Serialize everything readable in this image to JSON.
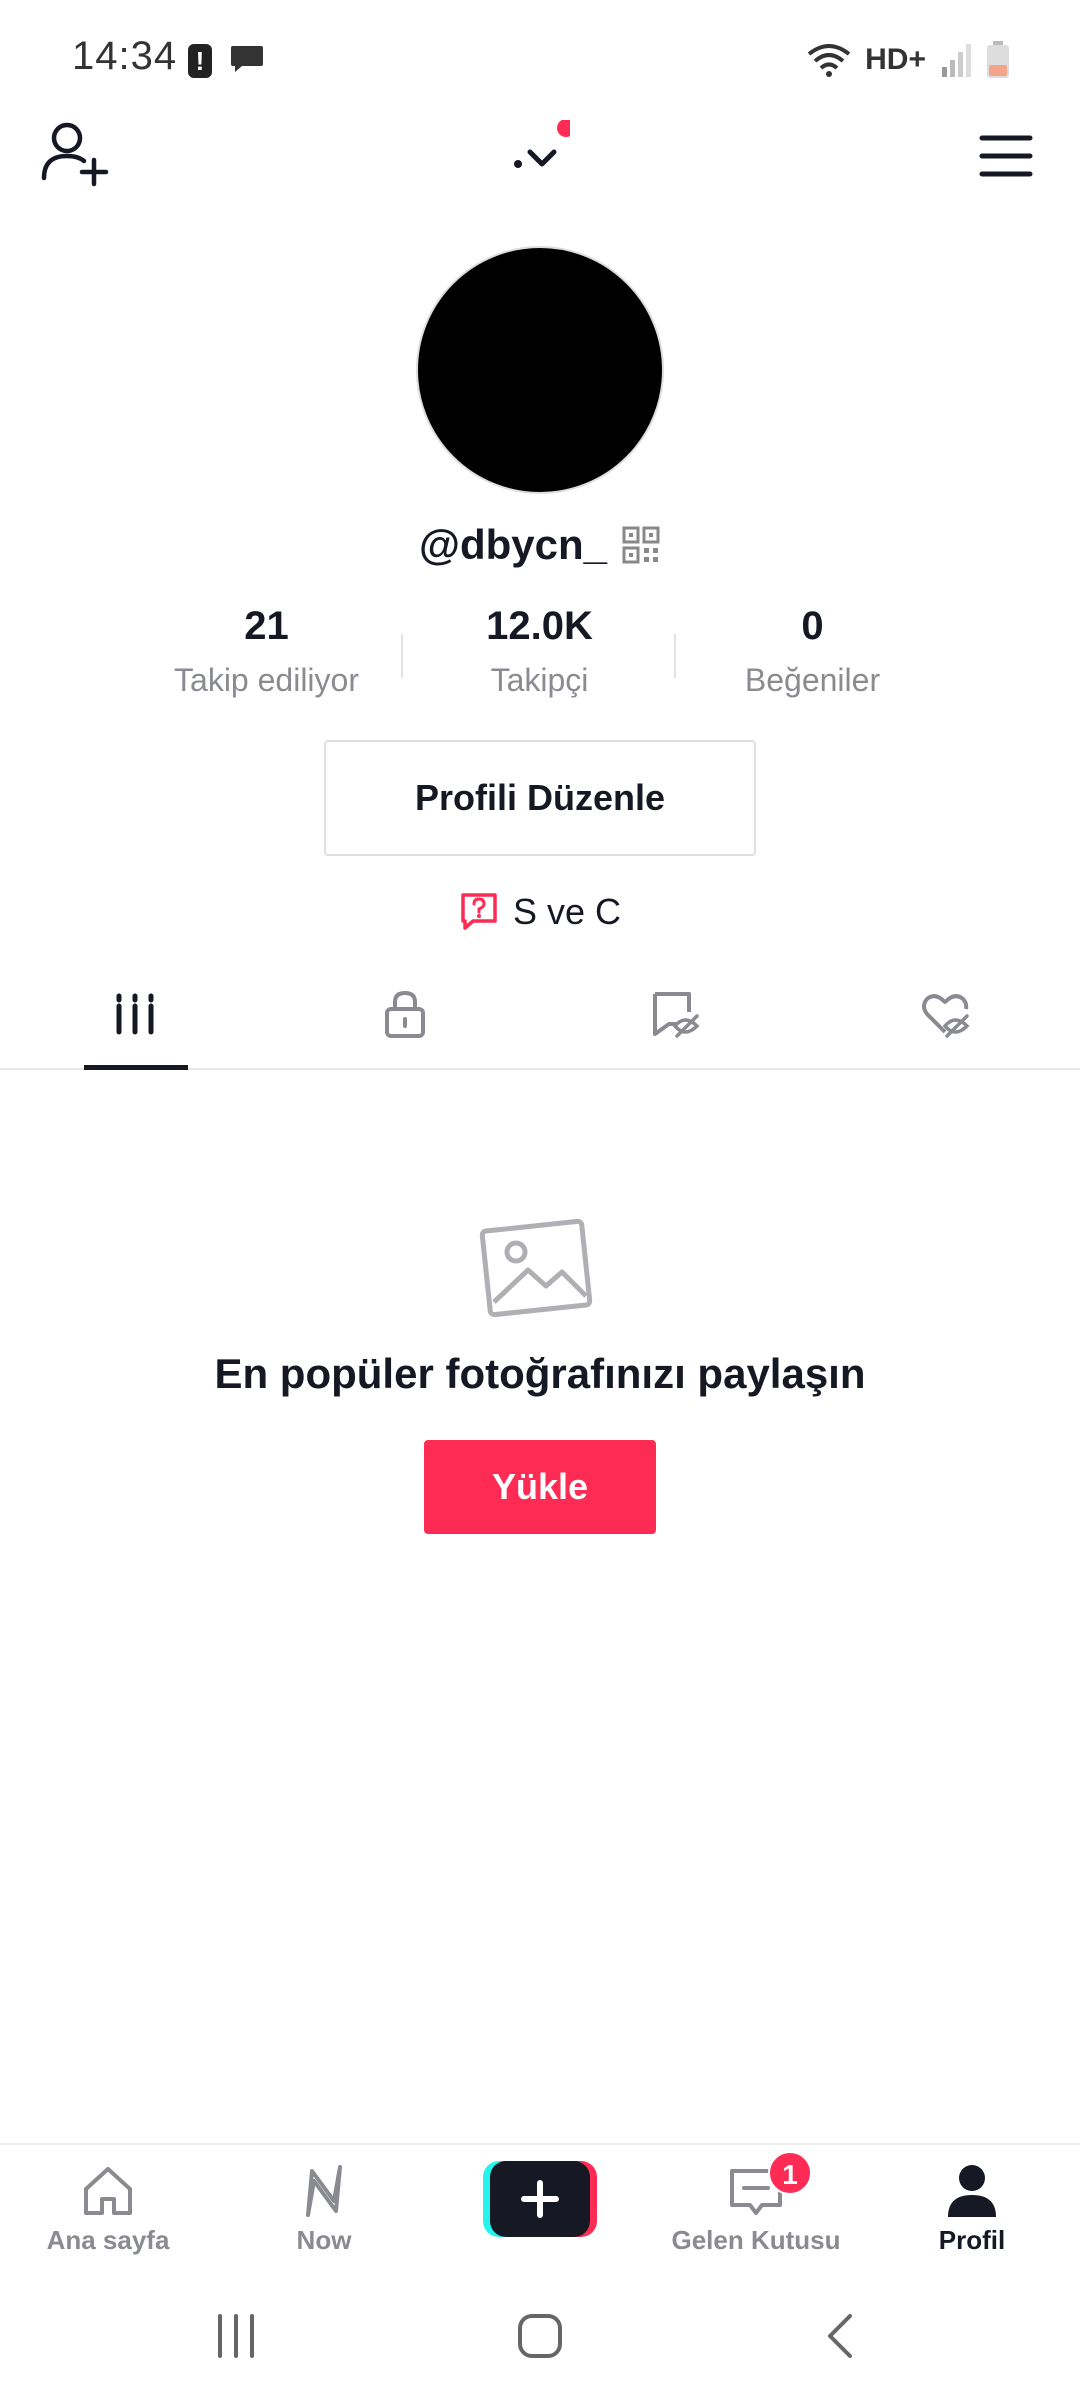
{
  "status_bar": {
    "time": "14:34",
    "alert_glyph": "!",
    "network_label": "HD+"
  },
  "profile": {
    "username": "@dbycn_",
    "stats": [
      {
        "value": "21",
        "label": "Takip ediliyor"
      },
      {
        "value": "12.0K",
        "label": "Takipçi"
      },
      {
        "value": "0",
        "label": "Beğeniler"
      }
    ],
    "edit_label": "Profili Düzenle",
    "bio": "S ve C"
  },
  "tabs": {
    "active": "videos",
    "items": [
      "grid-icon",
      "lock-icon",
      "hidden-posts-icon",
      "liked-hidden-icon"
    ]
  },
  "empty_state": {
    "title": "En popüler fotoğrafınızı paylaşın",
    "button_label": "Yükle"
  },
  "bottom_nav": {
    "items": [
      {
        "label": "Ana sayfa",
        "icon": "home-icon"
      },
      {
        "label": "Now",
        "icon": "now-icon"
      },
      {
        "label": "",
        "icon": "create-icon"
      },
      {
        "label": "Gelen Kutusu",
        "icon": "inbox-icon",
        "badge": "1"
      },
      {
        "label": "Profil",
        "icon": "profile-icon"
      }
    ]
  },
  "colors": {
    "accent": "#fe2c55",
    "text": "#161823",
    "muted": "#8a8b91"
  }
}
